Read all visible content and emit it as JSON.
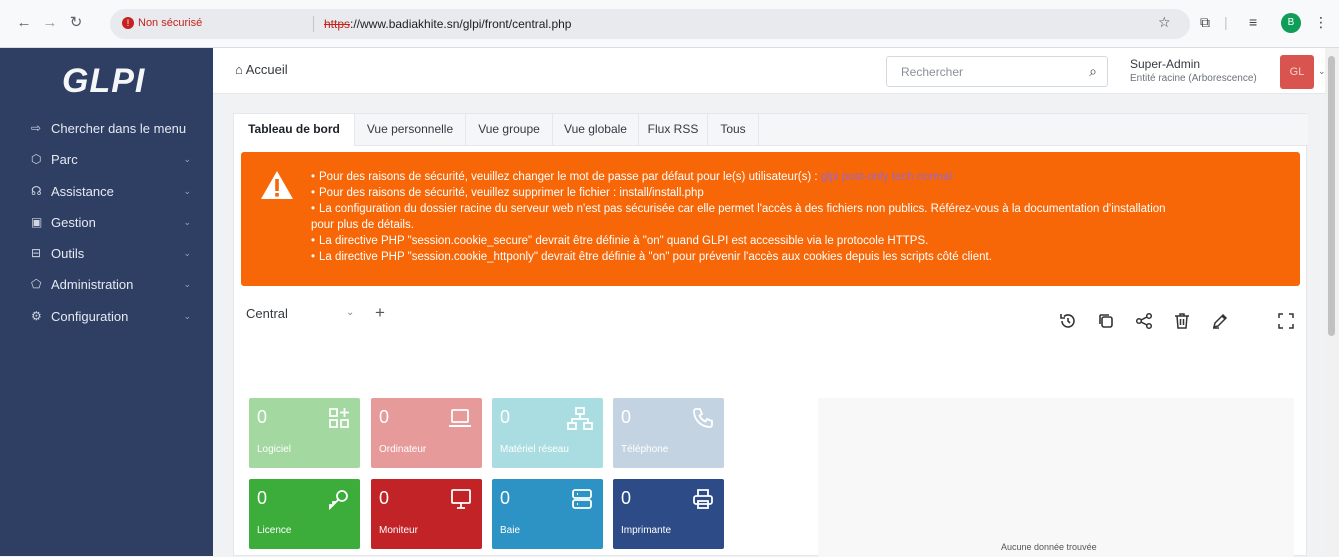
{
  "browser": {
    "security_label": "Non sécurisé",
    "url_scheme": "https",
    "url_rest": "://www.badiakhite.sn/glpi/front/central.php",
    "profile_initial": "B"
  },
  "sidebar": {
    "logo": "GLPI",
    "items": [
      {
        "label": "Chercher dans le menu",
        "icon": "arrow-right-icon"
      },
      {
        "label": "Parc",
        "icon": "box-icon"
      },
      {
        "label": "Assistance",
        "icon": "headset-icon"
      },
      {
        "label": "Gestion",
        "icon": "wallet-icon"
      },
      {
        "label": "Outils",
        "icon": "briefcase-icon"
      },
      {
        "label": "Administration",
        "icon": "shield-icon"
      },
      {
        "label": "Configuration",
        "icon": "gear-icon"
      }
    ]
  },
  "header": {
    "home_label": "Accueil",
    "search_placeholder": "Rechercher",
    "user_name": "Super-Admin",
    "user_entity": "Entité racine (Arborescence)",
    "avatar_initials": "GL"
  },
  "tabs": [
    "Tableau de bord",
    "Vue personnelle",
    "Vue groupe",
    "Vue globale",
    "Flux RSS",
    "Tous"
  ],
  "alert": {
    "line1": "Pour des raisons de sécurité, veuillez changer le mot de passe par défaut pour le(s) utilisateur(s) : ",
    "line1_link": "glpi post-only tech normal",
    "line2": "Pour des raisons de sécurité, veuillez supprimer le fichier : install/install.php",
    "line3": "La configuration du dossier racine du serveur web n'est pas sécurisée car elle permet l'accès à des fichiers non publics. Référez-vous à la documentation d'installation",
    "line3_cont": "pour plus de détails.",
    "line4": "La directive PHP \"session.cookie_secure\" devrait être définie à \"on\" quand GLPI est accessible via le protocole HTTPS.",
    "line5": "La directive PHP \"session.cookie_httponly\" devrait être définie à \"on\" pour prévenir l'accès aux cookies depuis les scripts côté client."
  },
  "dashboard": {
    "selected": "Central"
  },
  "tiles": [
    {
      "value": "0",
      "label": "Logiciel",
      "color": "#a3d8a1",
      "icon": "apps-icon"
    },
    {
      "value": "0",
      "label": "Ordinateur",
      "color": "#e79a9a",
      "icon": "laptop-icon"
    },
    {
      "value": "0",
      "label": "Matériel réseau",
      "color": "#a9dde1",
      "icon": "network-icon"
    },
    {
      "value": "0",
      "label": "Téléphone",
      "color": "#c4d3e2",
      "icon": "phone-icon"
    },
    {
      "value": "0",
      "label": "Licence",
      "color": "#3cac3a",
      "icon": "key-icon"
    },
    {
      "value": "0",
      "label": "Moniteur",
      "color": "#c22326",
      "icon": "monitor-icon"
    },
    {
      "value": "0",
      "label": "Baie",
      "color": "#2c93c4",
      "icon": "server-icon"
    },
    {
      "value": "0",
      "label": "Imprimante",
      "color": "#2d4c87",
      "icon": "printer-icon"
    }
  ],
  "empty_panel": {
    "text": "Aucune donnée trouvée"
  },
  "colors": {
    "sidebar": "#2f3f64",
    "alert": "#f76707",
    "avatar": "#d9534f"
  }
}
